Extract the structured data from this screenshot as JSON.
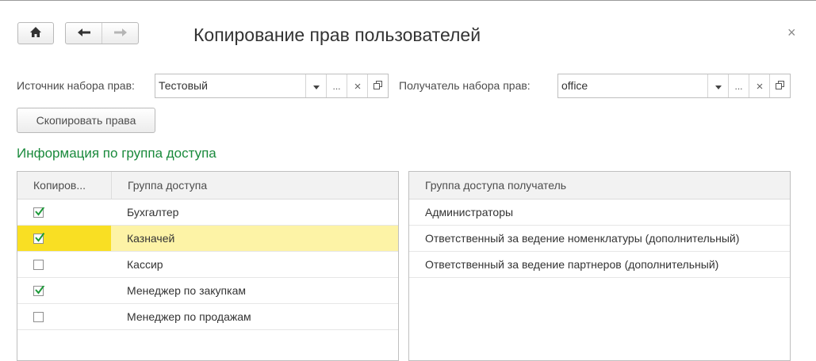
{
  "window": {
    "title": "Копирование прав пользователей",
    "close_glyph": "×"
  },
  "nav": {
    "home_icon": "home-icon",
    "back_icon": "arrow-left-icon",
    "forward_icon": "arrow-right-icon"
  },
  "source": {
    "label": "Источник набора прав:",
    "value": "Тестовый",
    "dots": "..."
  },
  "target": {
    "label": "Получатель набора прав:",
    "value": "office",
    "dots": "..."
  },
  "copy_button": {
    "label": "Скопировать права"
  },
  "section": {
    "title": "Информация по группа доступа"
  },
  "left_grid": {
    "headers": [
      "Копиров...",
      "Группа доступа"
    ],
    "rows": [
      {
        "checked": true,
        "group": "Бухгалтер"
      },
      {
        "checked": true,
        "group": "Казначей",
        "selected": true
      },
      {
        "checked": false,
        "group": "Кассир"
      },
      {
        "checked": true,
        "group": "Менеджер по закупкам"
      },
      {
        "checked": false,
        "group": "Менеджер по продажам"
      }
    ]
  },
  "right_grid": {
    "header": "Группа доступа получатель",
    "rows": [
      "Администраторы",
      "Ответственный за ведение номенклатуры (дополнительный)",
      "Ответственный за ведение партнеров (дополнительный)"
    ]
  },
  "colors": {
    "accent_green": "#1a8a3c",
    "selected_row": "#fdf3a6",
    "selected_cell": "#f9df23",
    "check_green": "#1e9a3a"
  }
}
